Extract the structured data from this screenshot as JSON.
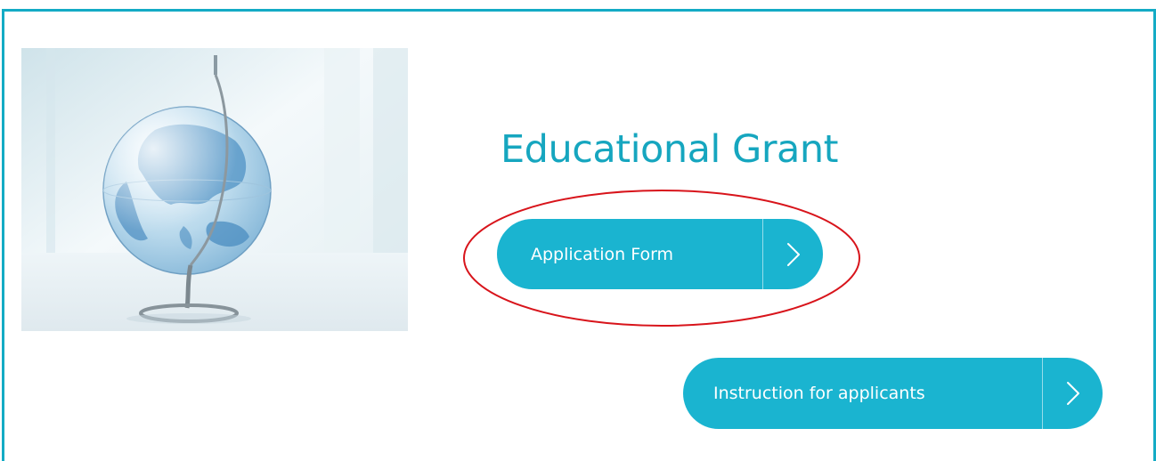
{
  "header": {
    "title": ""
  },
  "main": {
    "image": {
      "alt": "transparent globe on a stand",
      "icon": "globe-image"
    },
    "title": "Educational Grant",
    "buttons": {
      "application": {
        "label": "Application Form",
        "icon": "chevron-right-icon"
      },
      "instruction": {
        "label": "Instruction for applicants",
        "icon": "chevron-right-icon"
      }
    }
  },
  "annotation": {
    "shape": "ellipse",
    "target": "Application Form"
  },
  "colors": {
    "accent": "#14abc5",
    "button": "#1ab4d0",
    "title_text": "#16a6bf",
    "annotation": "#d8141b",
    "background": "#ffffff",
    "button_text": "#ffffff"
  }
}
